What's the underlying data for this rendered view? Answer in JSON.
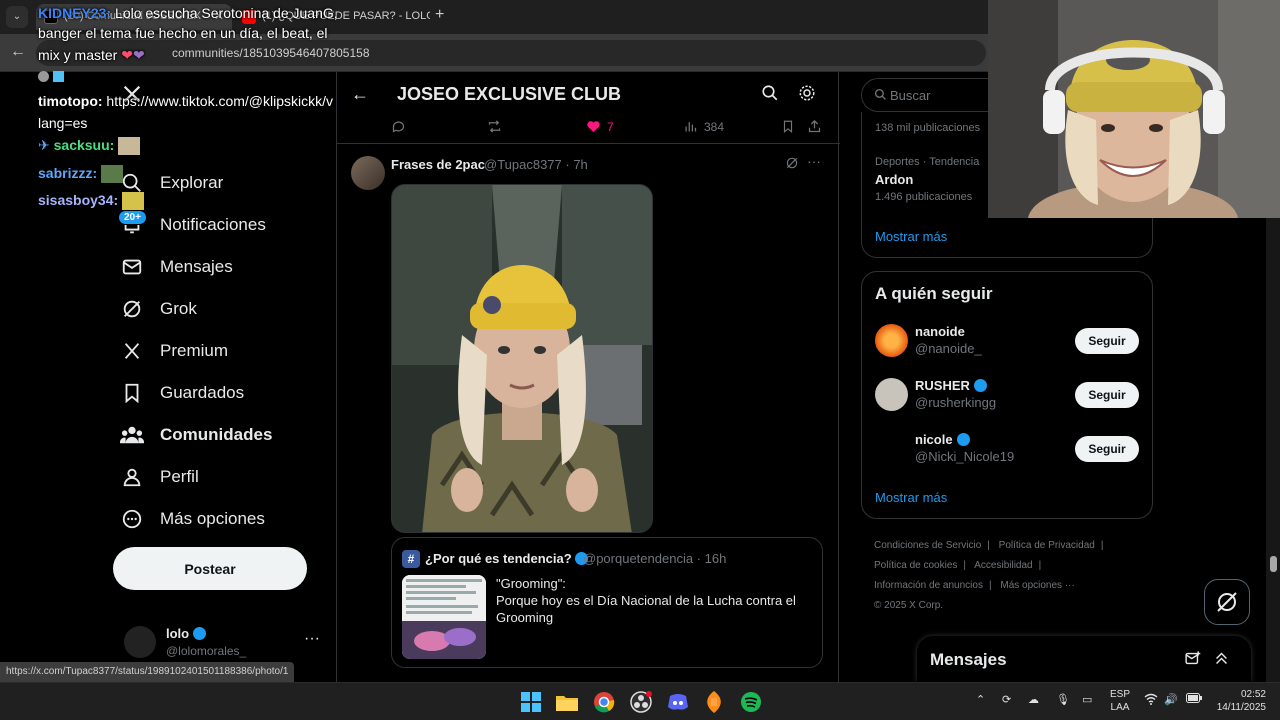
{
  "browser": {
    "tabs": [
      {
        "title": "(20) Comunidad JOSEO EX"
      },
      {
        "title": "(1) ¿QUE PUEDE PASAR? - LOLO"
      }
    ],
    "new_tab": "+",
    "url": "communities/1851039546407805158"
  },
  "chat": {
    "messages": [
      {
        "user": "KIDNEY23:",
        "text": " Lolo escucha Serotonina de JuanG,"
      },
      {
        "user": "",
        "text": "banger el tema fue hecho en un día, el beat, el"
      },
      {
        "user": "",
        "text": "mix y master"
      },
      {
        "user": "timotopo:",
        "text": " https://www.tiktok.com/@klipskickk/v"
      },
      {
        "user": "",
        "text": "lang=es"
      },
      {
        "user": "sacksuu:",
        "text": ""
      },
      {
        "user": "sabrizzz:",
        "text": ""
      },
      {
        "user": "sisasboy34:",
        "text": ""
      }
    ]
  },
  "nav": {
    "items": [
      {
        "label": "Explorar"
      },
      {
        "label": "Notificaciones"
      },
      {
        "label": "Mensajes"
      },
      {
        "label": "Grok"
      },
      {
        "label": "Premium"
      },
      {
        "label": "Guardados"
      },
      {
        "label": "Comunidades"
      },
      {
        "label": "Perfil"
      },
      {
        "label": "Más opciones"
      }
    ],
    "notif_badge": "20+",
    "post_button": "Postear",
    "account": {
      "name": "lolo",
      "handle": "@lolomorales_"
    }
  },
  "main": {
    "title": "JOSEO EXCLUSIVE CLUB",
    "actions": {
      "likes": "7",
      "views": "384"
    },
    "tweet": {
      "name": "Frases de 2pac",
      "handle": "@Tupac8377 · 7h"
    },
    "quote": {
      "name": "¿Por qué es tendencia?",
      "handle": "@porquetendencia · 16h",
      "title": "\"Grooming\":",
      "body": "Porque hoy es el Día Nacional de la Lucha contra el Grooming"
    }
  },
  "right": {
    "search_placeholder": "Buscar",
    "trends": {
      "count1": "138 mil publicaciones",
      "category": "Deportes · Tendencia",
      "name": "Ardon",
      "count2": "1.496 publicaciones",
      "more": "Mostrar más"
    },
    "follow": {
      "title": "A quién seguir",
      "users": [
        {
          "name": "nanoide",
          "handle": "@nanoide_",
          "button": "Seguir"
        },
        {
          "name": "RUSHER",
          "handle": "@rusherkingg",
          "button": "Seguir"
        },
        {
          "name": "nicole",
          "handle": "@Nicki_Nicole19",
          "button": "Seguir"
        }
      ],
      "more": "Mostrar más"
    },
    "footer": {
      "links": [
        "Condiciones de Servicio",
        "Política de Privacidad",
        "Política de cookies",
        "Accesibilidad",
        "Información de anuncios",
        "Más opciones ···"
      ],
      "copyright": "© 2025 X Corp."
    },
    "messages_drawer": "Mensajes"
  },
  "status_url": "https://x.com/Tupac8377/status/1989102401501188386/photo/1",
  "taskbar": {
    "lang1": "ESP",
    "lang2": "LAA",
    "time": "02:52",
    "date": "14/11/2025"
  },
  "colors": {
    "accent": "#1d9bf0",
    "background": "#000000",
    "like": "#f91880"
  }
}
